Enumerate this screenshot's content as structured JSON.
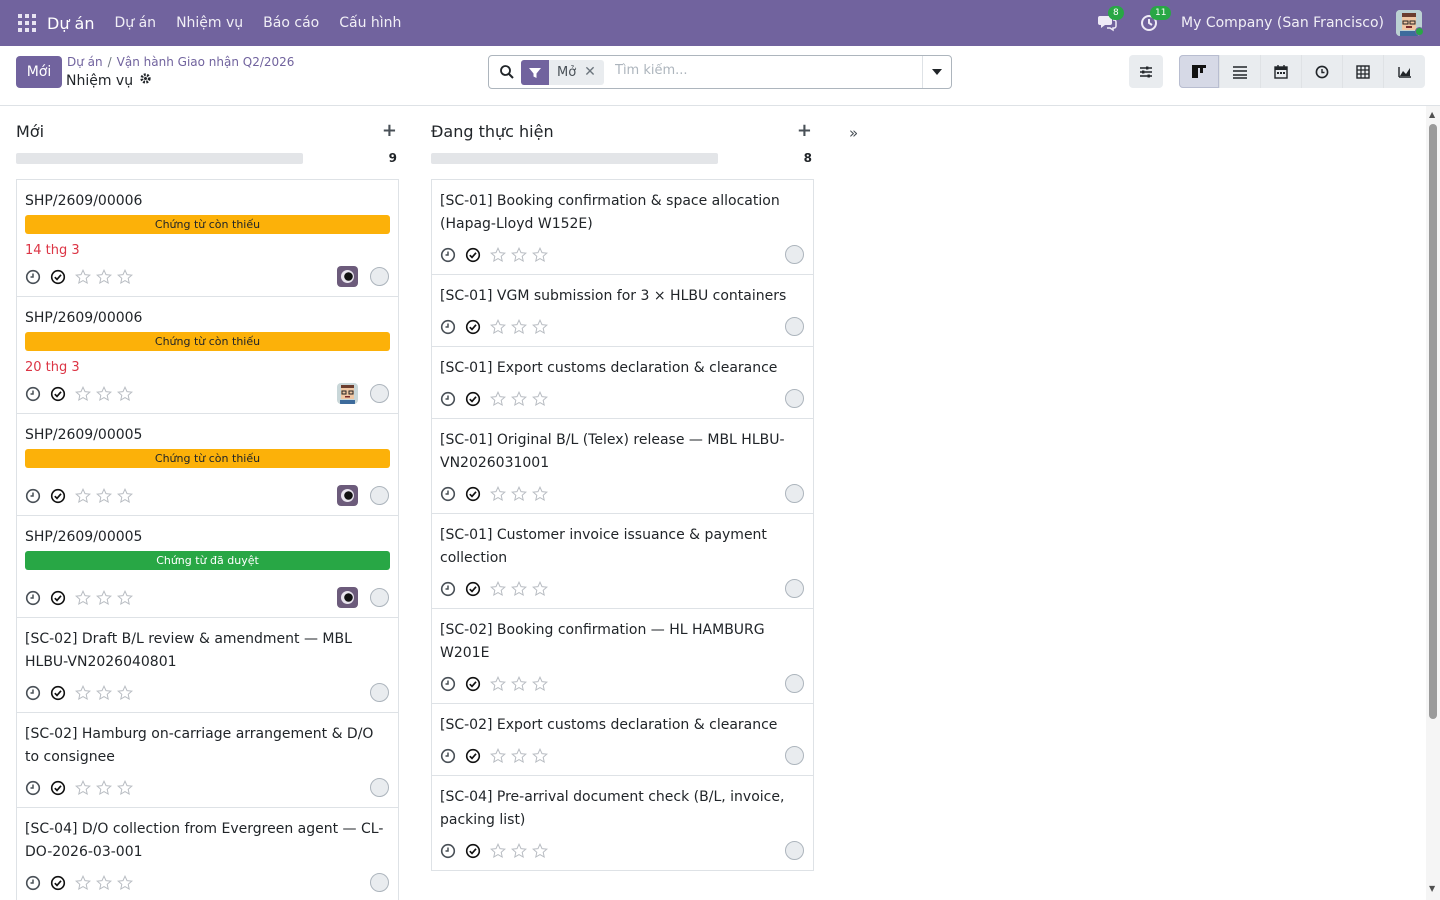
{
  "navbar": {
    "brand": "Dự án",
    "menu": [
      "Dự án",
      "Nhiệm vụ",
      "Báo cáo",
      "Cấu hình"
    ],
    "messages_badge": "8",
    "activities_badge": "11",
    "company": "My Company (San Francisco)"
  },
  "control": {
    "new_button": "Mới",
    "breadcrumb": [
      "Dự án",
      "Vận hành Giao nhận Q2/2026"
    ],
    "title": "Nhiệm vụ",
    "filter_facet": "Mở",
    "search_placeholder": "Tìm kiếm..."
  },
  "columns": [
    {
      "title": "Mới",
      "count": "9",
      "cards": [
        {
          "name": "SHP/2609/00006",
          "tag": "Chứng từ còn thiếu",
          "tag_color": "#fcb109",
          "deadline": "14 thg 3",
          "avatar": "dark"
        },
        {
          "name": "SHP/2609/00006",
          "tag": "Chứng từ còn thiếu",
          "tag_color": "#fcb109",
          "deadline": "20 thg 3",
          "avatar": "face"
        },
        {
          "name": "SHP/2609/00005",
          "tag": "Chứng từ còn thiếu",
          "tag_color": "#fcb109",
          "deadline": "",
          "avatar": "dark"
        },
        {
          "name": "SHP/2609/00005",
          "tag": "Chứng từ đã duyệt",
          "tag_color": "#28a745",
          "deadline": "",
          "avatar": "dark"
        },
        {
          "name": "[SC-02] Draft B/L review & amendment — MBL HLBU-VN2026040801",
          "tag": "",
          "deadline": "",
          "avatar": ""
        },
        {
          "name": "[SC-02] Hamburg on-carriage arrangement & D/O to consignee",
          "tag": "",
          "deadline": "",
          "avatar": ""
        },
        {
          "name": "[SC-04] D/O collection from Evergreen agent — CL-DO-2026-03-001",
          "tag": "",
          "deadline": "",
          "avatar": ""
        }
      ]
    },
    {
      "title": "Đang thực hiện",
      "count": "8",
      "cards": [
        {
          "name": "[SC-01] Booking confirmation & space allocation (Hapag-Lloyd W152E)",
          "tag": "",
          "deadline": "",
          "avatar": ""
        },
        {
          "name": "[SC-01] VGM submission for 3 × HLBU containers",
          "tag": "",
          "deadline": "",
          "avatar": ""
        },
        {
          "name": "[SC-01] Export customs declaration & clearance",
          "tag": "",
          "deadline": "",
          "avatar": ""
        },
        {
          "name": "[SC-01] Original B/L (Telex) release — MBL HLBU-VN2026031001",
          "tag": "",
          "deadline": "",
          "avatar": ""
        },
        {
          "name": "[SC-01] Customer invoice issuance & payment collection",
          "tag": "",
          "deadline": "",
          "avatar": ""
        },
        {
          "name": "[SC-02] Booking confirmation — HL HAMBURG W201E",
          "tag": "",
          "deadline": "",
          "avatar": ""
        },
        {
          "name": "[SC-02] Export customs declaration & clearance",
          "tag": "",
          "deadline": "",
          "avatar": ""
        },
        {
          "name": "[SC-04] Pre-arrival document check (B/L, invoice, packing list)",
          "tag": "",
          "deadline": "",
          "avatar": ""
        }
      ]
    }
  ],
  "colors": {
    "brand": "#71639e",
    "warning_tag": "#fcb109",
    "success_tag": "#28a745",
    "deadline": "#dc3545"
  },
  "icons": {
    "clock": "clock-icon",
    "check": "check-circle-icon",
    "star": "star-outline-icon"
  }
}
